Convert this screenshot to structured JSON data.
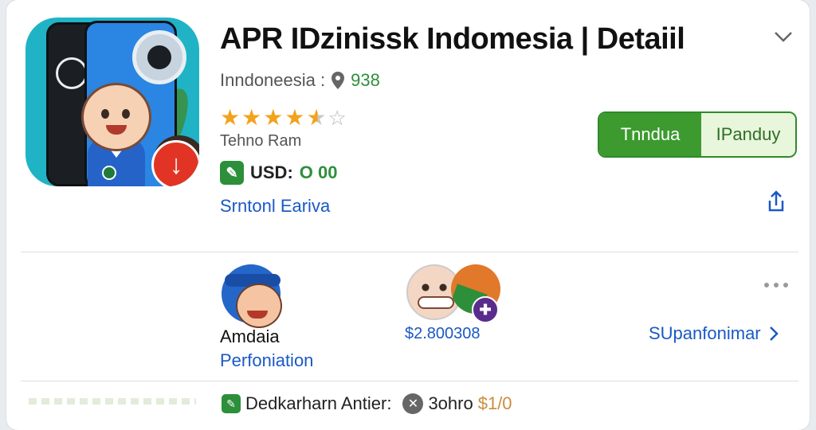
{
  "app": {
    "title": "APR IDzinissk Indomesia | Detaiil",
    "subtitle_prefix": "Inndoneesia :",
    "subtitle_count": "938",
    "rating": 4.5,
    "rating_max": 5,
    "author": "Tehno Ram",
    "price_label": "USD:",
    "price_value": "O 00",
    "link_text": "Srntonl Eariva"
  },
  "buttons": {
    "primary": "Tnndua",
    "secondary": "IPanduy"
  },
  "people": {
    "name": "Amdaia",
    "role": "Perfoniation",
    "amount": "$2.800308",
    "see_all": "SUpanfonimar"
  },
  "bottom": {
    "label": "Dedkarharn Antier:",
    "item": "3ohro",
    "price": "$1/0"
  },
  "icons": {
    "chevron": "chevron-down-icon",
    "pin": "location-pin-icon",
    "share": "share-icon",
    "more": "more-dots-icon",
    "download": "download-arrow-icon"
  },
  "colors": {
    "primary_green": "#3c9a2f",
    "link_blue": "#1a59c4",
    "star": "#f2a31b"
  }
}
